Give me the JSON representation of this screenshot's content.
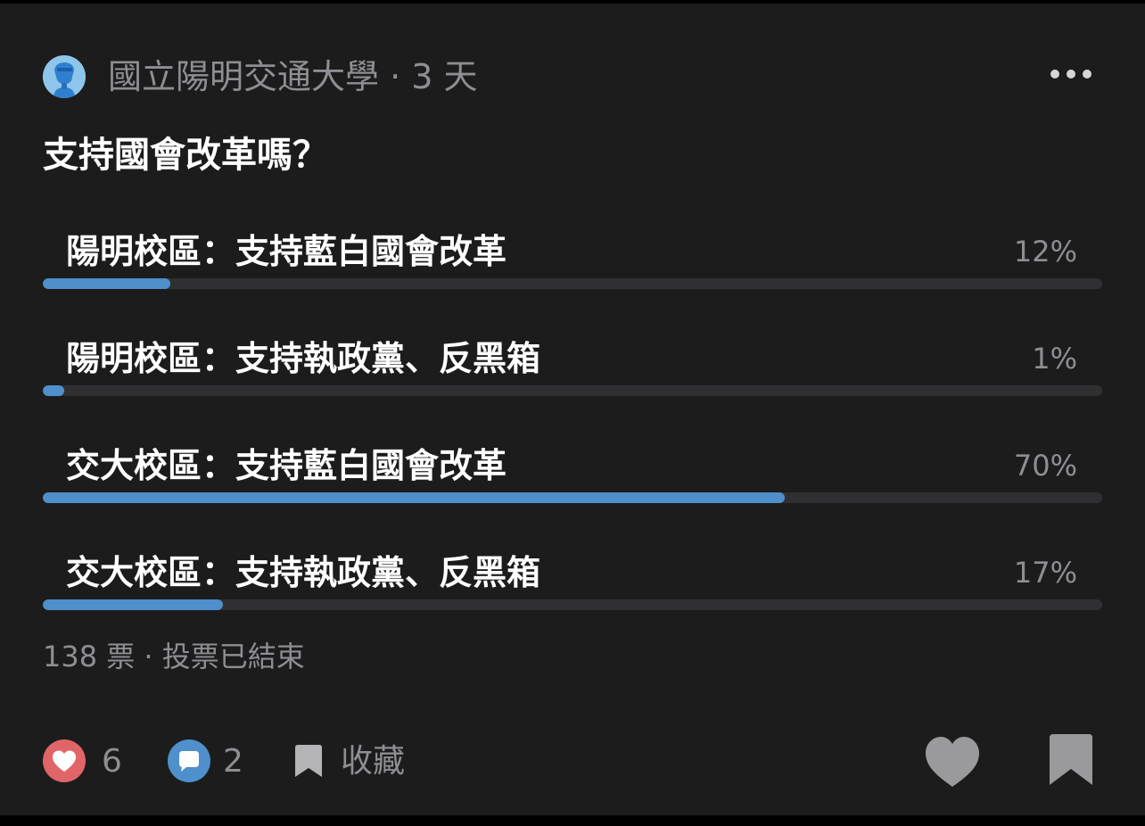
{
  "post": {
    "board_name": "國立陽明交通大學",
    "time_ago": "· 3 天",
    "question": "支持國會改革嗎？"
  },
  "poll": {
    "options": [
      {
        "label": "陽明校區：支持藍白國會改革",
        "percent_text": "12%",
        "value": 0.12
      },
      {
        "label": "陽明校區：支持執政黨、反黑箱",
        "percent_text": "1%",
        "value": 0.01
      },
      {
        "label": "交大校區：支持藍白國會改革",
        "percent_text": "70%",
        "value": 0.7
      },
      {
        "label": "交大校區：支持執政黨、反黑箱",
        "percent_text": "17%",
        "value": 0.17
      }
    ],
    "summary": "138 票 · 投票已結束"
  },
  "actions": {
    "like_count": "6",
    "comment_count": "2",
    "save_label": "收藏"
  },
  "colors": {
    "card_background": "#1c1c1d",
    "bar_fill": "#4f8fcb",
    "bar_track": "#303032",
    "like_red": "#e06569",
    "comment_blue": "#4f8fcb"
  },
  "icons": {
    "avatar": "school-avatar-icon",
    "more": "more-dots-icon",
    "like": "heart-reaction-icon",
    "comment": "comment-bubble-icon",
    "save": "bookmark-icon",
    "react": "heart-icon",
    "bookmark_large": "bookmark-large-icon"
  }
}
